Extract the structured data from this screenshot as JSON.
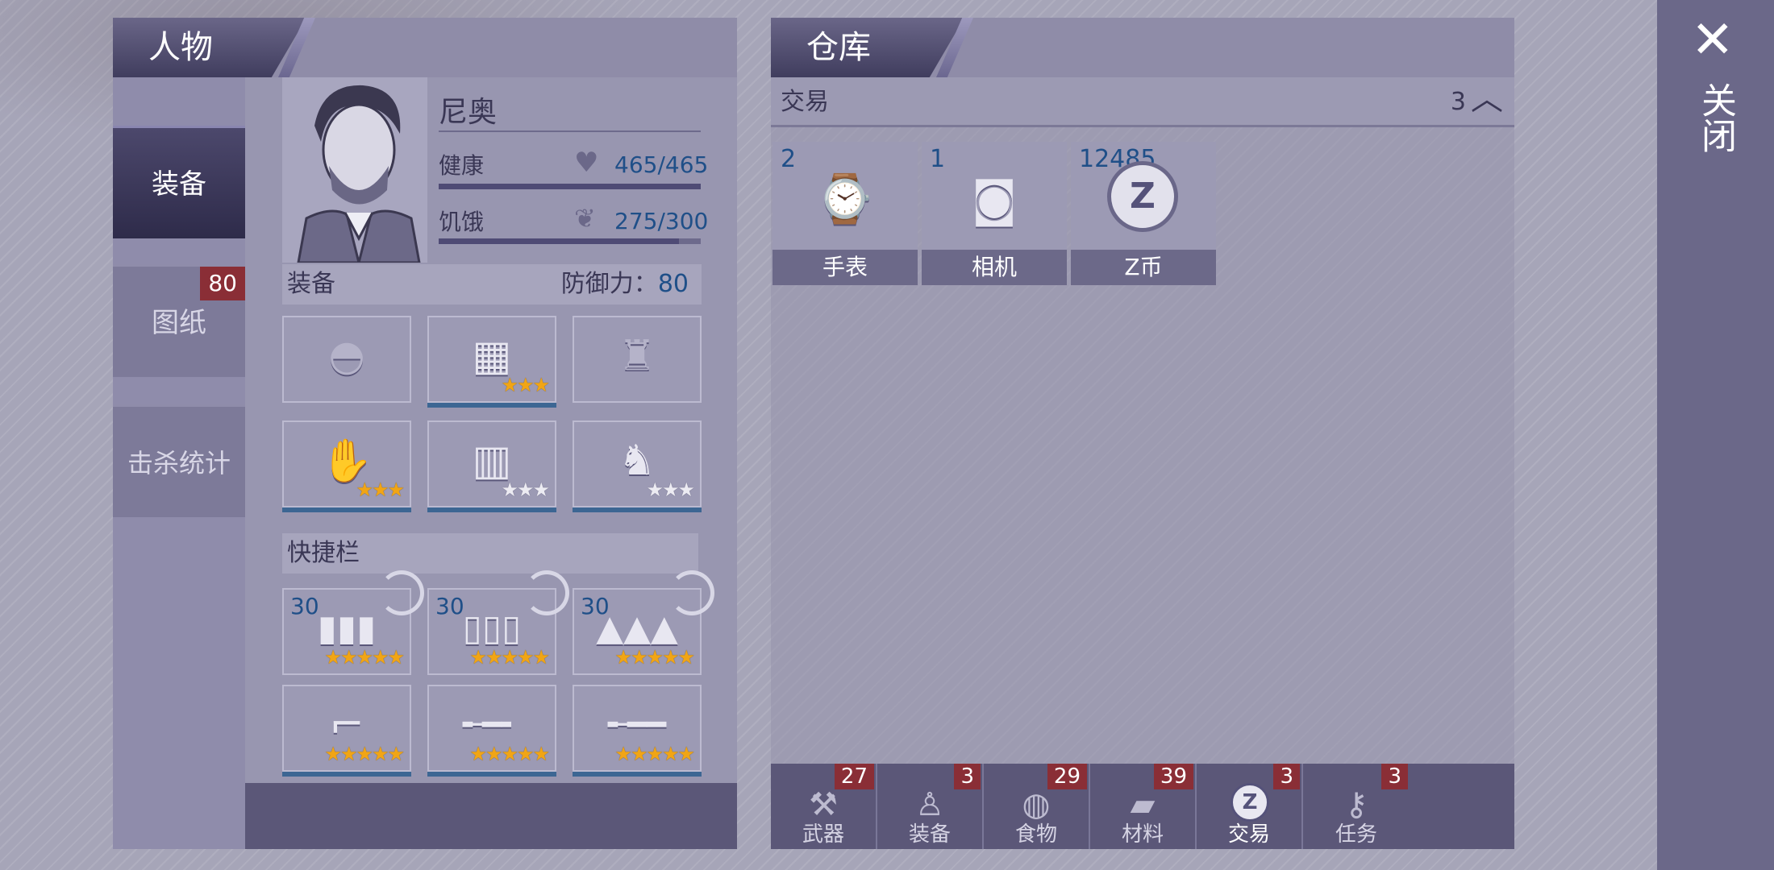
{
  "character_panel": {
    "title": "人物",
    "side_tabs": [
      {
        "label": "装备",
        "active": true
      },
      {
        "label": "图纸",
        "badge": "80"
      },
      {
        "label": "击杀统计"
      }
    ],
    "name": "尼奥",
    "health": {
      "label": "健康",
      "value": "465/465",
      "fraction": 1.0
    },
    "hunger": {
      "label": "饥饿",
      "value": "275/300",
      "fraction": 0.917
    },
    "equipment": {
      "label": "装备",
      "defense_label": "防御力：",
      "defense_value": "80",
      "slots": [
        {
          "icon": "helmet-icon",
          "stars": 0
        },
        {
          "icon": "armor-vest-icon",
          "stars": 3
        },
        {
          "icon": "jacket-icon",
          "stars": 0
        },
        {
          "icon": "gloves-icon",
          "stars": 3
        },
        {
          "icon": "shorts-icon",
          "stars": 3
        },
        {
          "icon": "boots-icon",
          "stars": 3
        }
      ]
    },
    "quickbar": {
      "label": "快捷栏",
      "ammo": [
        {
          "count": "30",
          "icon": "pistol-ammo-icon",
          "stars": 5
        },
        {
          "count": "30",
          "icon": "shotgun-shells-icon",
          "stars": 5
        },
        {
          "count": "30",
          "icon": "rifle-ammo-icon",
          "stars": 5
        }
      ],
      "weapons": [
        {
          "icon": "revolver-icon",
          "stars": 5
        },
        {
          "icon": "shotgun-icon",
          "stars": 5
        },
        {
          "icon": "rifle-icon",
          "stars": 5
        }
      ]
    }
  },
  "warehouse_panel": {
    "title": "仓库",
    "category": {
      "label": "交易",
      "count": "3"
    },
    "items": [
      {
        "count": "2",
        "label": "手表",
        "icon": "watch-icon"
      },
      {
        "count": "1",
        "label": "相机",
        "icon": "camera-icon"
      },
      {
        "count": "12485",
        "label": "Z币",
        "icon": "z-coin-icon"
      }
    ],
    "tabs": [
      {
        "label": "武器",
        "badge": "27",
        "icon": "axe-icon"
      },
      {
        "label": "装备",
        "badge": "3",
        "icon": "shirt-icon"
      },
      {
        "label": "食物",
        "badge": "29",
        "icon": "bread-icon"
      },
      {
        "label": "材料",
        "badge": "39",
        "icon": "wood-log-icon"
      },
      {
        "label": "交易",
        "badge": "3",
        "icon": "z-coin-icon",
        "selected": true
      },
      {
        "label": "任务",
        "badge": "3",
        "icon": "key-icon"
      }
    ]
  },
  "close": {
    "label": "关闭",
    "icon": "close-icon"
  },
  "colors": {
    "badge": "#8a2e36",
    "value_text": "#1f4f88",
    "star_gold": "#f1a515",
    "panel_dark": "#5b5778"
  }
}
